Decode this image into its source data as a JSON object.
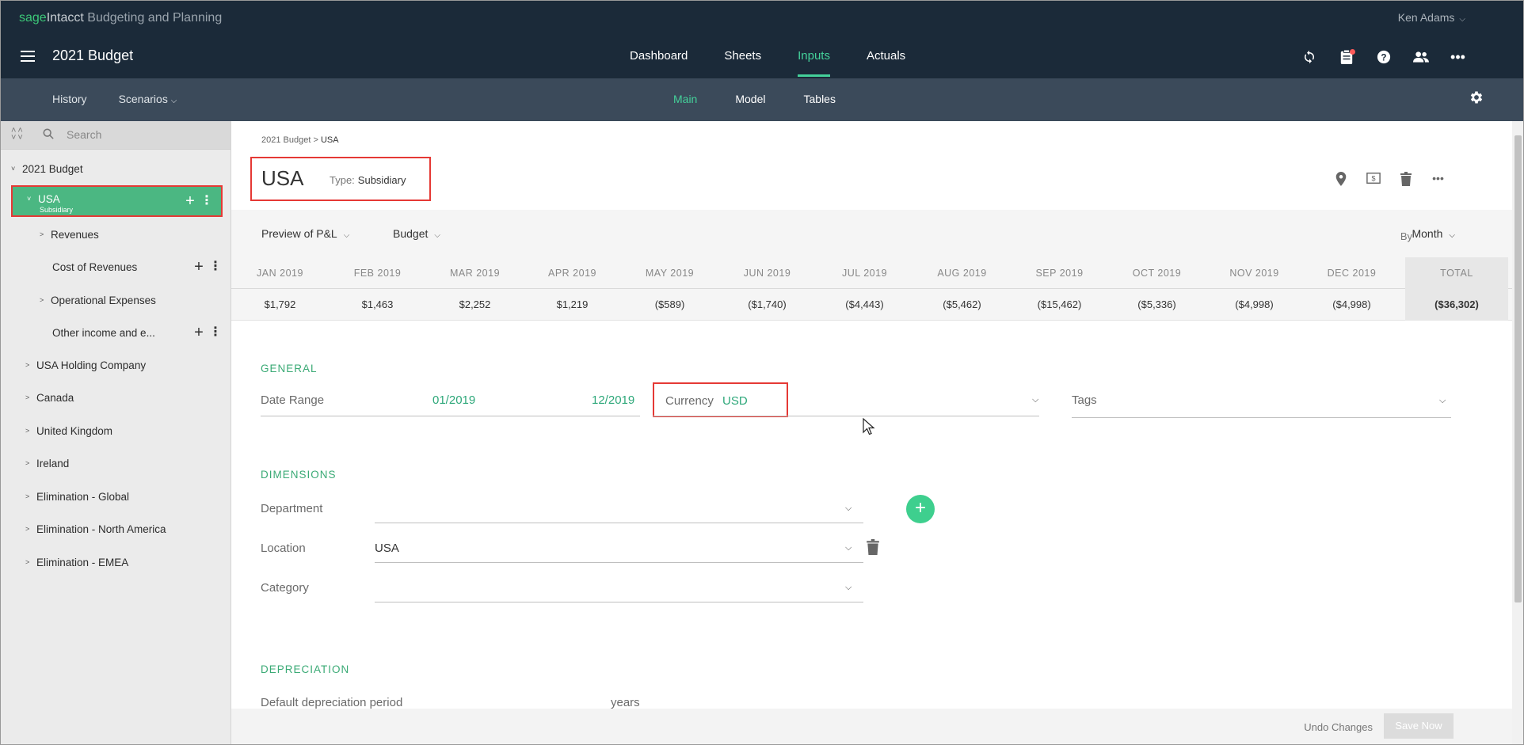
{
  "header": {
    "brand_sage": "sage",
    "brand_intacct": "Intacct",
    "brand_product": " Budgeting and Planning",
    "user_name": "Ken Adams",
    "budget_title": "2021 Budget",
    "nav": [
      "Dashboard",
      "Sheets",
      "Inputs",
      "Actuals"
    ],
    "active_nav": "Inputs",
    "icons": [
      "refresh-icon",
      "clipboard-icon",
      "help-icon",
      "users-icon",
      "more-icon"
    ]
  },
  "subheader": {
    "left": [
      "History",
      "Scenarios"
    ],
    "center": [
      "Main",
      "Model",
      "Tables"
    ],
    "active_center": "Main"
  },
  "sidebar": {
    "search_placeholder": "Search",
    "root": "2021 Budget",
    "selected": {
      "label": "USA",
      "sublabel": "Subsidiary"
    },
    "children": [
      "Revenues",
      "Cost of Revenues",
      "Operational Expenses",
      "Other income and e..."
    ],
    "siblings": [
      "USA Holding Company",
      "Canada",
      "United Kingdom",
      "Ireland",
      "Elimination - Global",
      "Elimination - North America",
      "Elimination - EMEA"
    ]
  },
  "main": {
    "breadcrumb_parent": "2021 Budget",
    "breadcrumb_sep": " > ",
    "breadcrumb_current": "USA",
    "title": "USA",
    "type_label": "Type:",
    "type_value": "Subsidiary",
    "preview": "Preview of P&L",
    "scenario": "Budget",
    "by_label": "By",
    "period": "Month",
    "months": [
      "JAN 2019",
      "FEB 2019",
      "MAR 2019",
      "APR 2019",
      "MAY 2019",
      "JUN 2019",
      "JUL 2019",
      "AUG 2019",
      "SEP 2019",
      "OCT 2019",
      "NOV 2019",
      "DEC 2019"
    ],
    "values": [
      "$1,792",
      "$1,463",
      "$2,252",
      "$1,219",
      "($589)",
      "($1,740)",
      "($4,443)",
      "($5,462)",
      "($15,462)",
      "($5,336)",
      "($4,998)",
      "($4,998)"
    ],
    "total_label": "TOTAL",
    "total_value": "($36,302)",
    "general": {
      "title": "GENERAL",
      "date_range_label": "Date Range",
      "date_from": "01/2019",
      "date_to": "12/2019",
      "currency_label": "Currency",
      "currency_value": "USD",
      "tags_label": "Tags"
    },
    "dimensions": {
      "title": "DIMENSIONS",
      "department_label": "Department",
      "department_value": "",
      "location_label": "Location",
      "location_value": "USA",
      "category_label": "Category",
      "category_value": ""
    },
    "depreciation": {
      "title": "DEPRECIATION",
      "period_label": "Default depreciation period",
      "unit": "years"
    },
    "undo": "Undo Changes",
    "save": "Save Now"
  },
  "colors": {
    "header_bg": "#1b2a39",
    "subheader_bg": "#3b4a5a",
    "accent_green": "#44d19a",
    "selected_row": "#4bb782",
    "highlight_red": "#e53935"
  }
}
